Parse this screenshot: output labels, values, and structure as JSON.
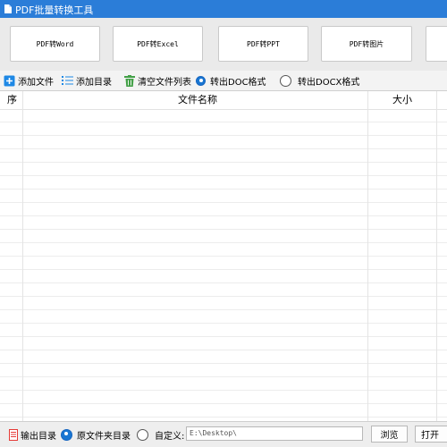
{
  "window": {
    "title": "PDF批量转换工具"
  },
  "convert_buttons": [
    {
      "label": "PDF转Word"
    },
    {
      "label": "PDF转Excel"
    },
    {
      "label": "PDF转PPT"
    },
    {
      "label": "PDF转图片"
    }
  ],
  "toolbar": {
    "add_file": "添加文件",
    "add_dir": "添加目录",
    "clear_list": "清空文件列表",
    "out_doc": "转出DOC格式",
    "out_docx": "转出DOCX格式",
    "selected_format": "DOC"
  },
  "table": {
    "columns": {
      "index": "序",
      "name": "文件名称",
      "size": "大小"
    },
    "rows": []
  },
  "bottom": {
    "output_dir_label": "输出目录",
    "source_dir": "原文件夹目录",
    "custom": "自定义:",
    "path_value": "E:\\Desktop\\",
    "browse": "浏览",
    "open": "打开"
  },
  "colors": {
    "titlebar": "#2b7dd8",
    "accent": "#1976d2"
  }
}
